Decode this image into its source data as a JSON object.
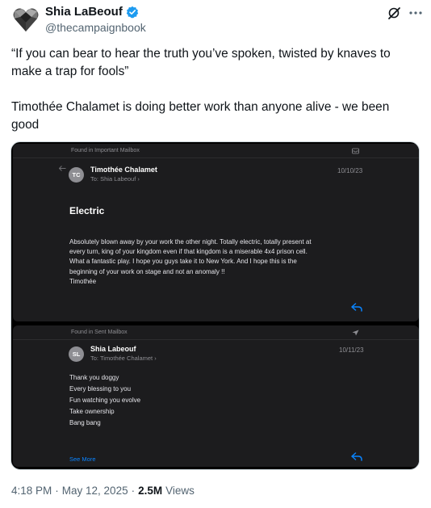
{
  "author": {
    "display_name": "Shia LaBeouf",
    "handle": "@thecampaignbook",
    "avatar_icon": "heart-logo-icon",
    "verified_color": "#1d9bf0"
  },
  "tweet": {
    "line1": "“If you can bear to hear the truth you’ve spoken, twisted by knaves to make a trap for fools”",
    "line2": "Timothée Chalamet is doing better work than anyone alive - we been good"
  },
  "email1": {
    "mailbox": "Found in Important Mailbox",
    "avatar_initials": "TC",
    "sender": "Timothée Chalamet",
    "to_prefix": "To:",
    "recipient": "Shia Labeouf",
    "recipient_chevron": "›",
    "date": "10/10/23",
    "subject": "Electric",
    "body": "Absolutely blown away by your work the other night. Totally electric, totally present at\nevery turn, king of your kingdom even if that kingdom is a miserable 4x4 prison cell.\nWhat a fantastic play. I hope you guys take it to New York. And I hope this is the\nbeginning of your work on stage and not an anomaly !!\nTimothée"
  },
  "email2": {
    "mailbox": "Found in Sent Mailbox",
    "avatar_initials": "SL",
    "sender": "Shia Labeouf",
    "to_prefix": "To:",
    "recipient": "Timothée Chalamet",
    "recipient_chevron": "›",
    "date": "10/11/23",
    "body": "Thank you doggy\nEvery blessing to you\nFun watching you evolve\nTake ownership\nBang bang",
    "see_more": "See More"
  },
  "footer": {
    "time": "4:18 PM",
    "separator": "·",
    "date": "May 12, 2025",
    "separator2": "·",
    "views_count": "2.5M",
    "views_label": "Views"
  },
  "colors": {
    "link_blue": "#0a84ff",
    "mail_bg": "#1c1c1e"
  }
}
